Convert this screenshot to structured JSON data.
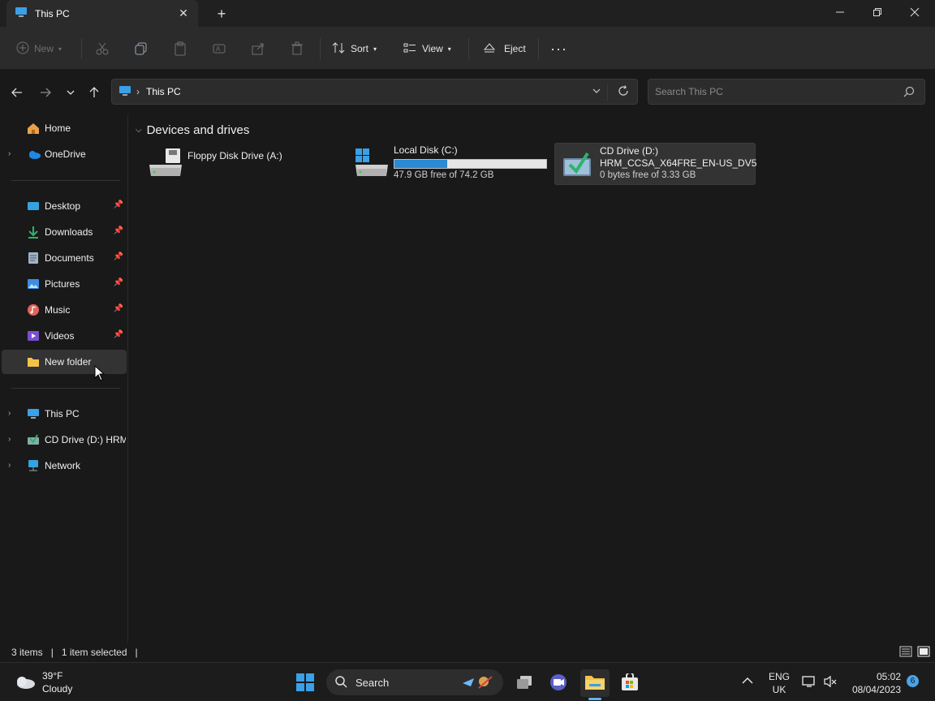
{
  "window": {
    "tab_title": "This PC",
    "new_tab": "+"
  },
  "toolbar": {
    "new_label": "New",
    "sort_label": "Sort",
    "view_label": "View",
    "eject_label": "Eject",
    "more_label": "···"
  },
  "address": {
    "crumb": "This PC",
    "search_placeholder": "Search This PC"
  },
  "sidebar": {
    "items": [
      {
        "label": "Home"
      },
      {
        "label": "OneDrive"
      },
      {
        "label": "Desktop"
      },
      {
        "label": "Downloads"
      },
      {
        "label": "Documents"
      },
      {
        "label": "Pictures"
      },
      {
        "label": "Music"
      },
      {
        "label": "Videos"
      },
      {
        "label": "New folder"
      },
      {
        "label": "This PC"
      },
      {
        "label": "CD Drive (D:) HRM_"
      },
      {
        "label": "Network"
      }
    ]
  },
  "content": {
    "group_title": "Devices and drives",
    "drives": [
      {
        "name": "Floppy Disk Drive (A:)",
        "free": ""
      },
      {
        "name": "Local Disk (C:)",
        "free": "47.9 GB free of 74.2 GB",
        "used_fraction": 0.35
      },
      {
        "name": "CD Drive (D:)",
        "name2": "HRM_CCSA_X64FRE_EN-US_DV5",
        "free": "0 bytes free of 3.33 GB"
      }
    ]
  },
  "status": {
    "items": "3 items",
    "selected": "1 item selected"
  },
  "taskbar": {
    "temp": "39°F",
    "weather": "Cloudy",
    "search_label": "Search",
    "lang1": "ENG",
    "lang2": "UK",
    "time": "05:02",
    "date": "08/04/2023",
    "notif_count": "6"
  },
  "colors": {
    "accent": "#2a8ad4",
    "background": "#191919"
  }
}
